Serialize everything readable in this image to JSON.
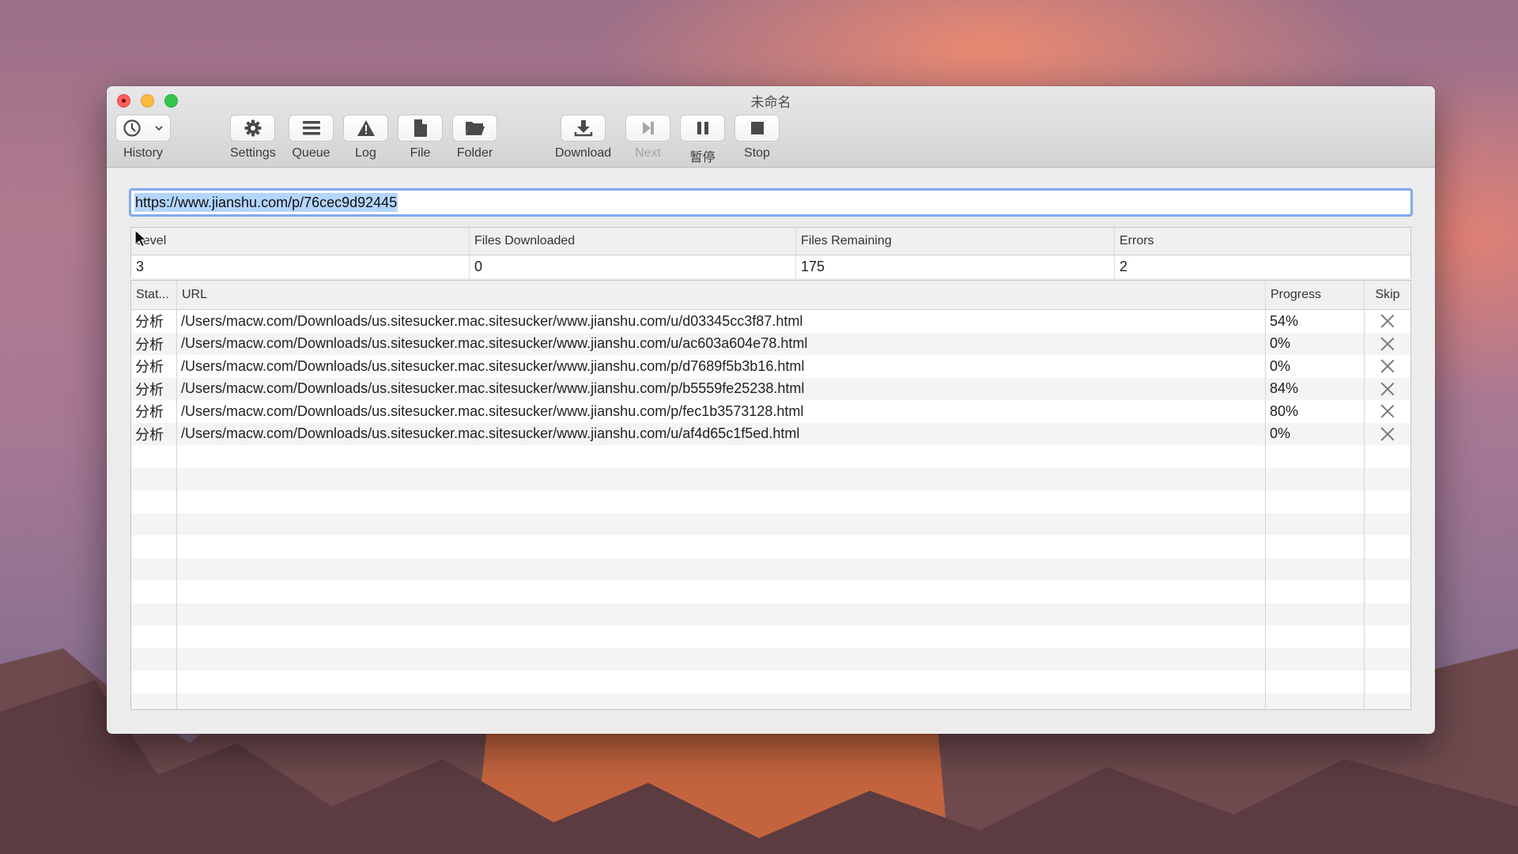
{
  "window": {
    "title": "未命名"
  },
  "toolbar": {
    "items": [
      {
        "label": "History",
        "icon": "clock-icon",
        "has_dropdown": true,
        "enabled": true
      },
      {
        "label": "Settings",
        "icon": "gear-icon",
        "enabled": true
      },
      {
        "label": "Queue",
        "icon": "list-icon",
        "enabled": true
      },
      {
        "label": "Log",
        "icon": "warning-icon",
        "enabled": true
      },
      {
        "label": "File",
        "icon": "file-icon",
        "enabled": true
      },
      {
        "label": "Folder",
        "icon": "folder-icon",
        "enabled": true
      },
      {
        "label": "Download",
        "icon": "download-icon",
        "enabled": true
      },
      {
        "label": "Next",
        "icon": "skip-next-icon",
        "enabled": false
      },
      {
        "label": "暂停",
        "icon": "pause-icon",
        "enabled": true
      },
      {
        "label": "Stop",
        "icon": "stop-icon",
        "enabled": true
      }
    ]
  },
  "url_field": {
    "value": "https://www.jianshu.com/p/76cec9d92445",
    "selected": true
  },
  "stats": {
    "headers": [
      "Level",
      "Files Downloaded",
      "Files Remaining",
      "Errors"
    ],
    "values": [
      "3",
      "0",
      "175",
      "2"
    ]
  },
  "queue": {
    "headers": [
      "Stat...",
      "URL",
      "Progress",
      "Skip"
    ],
    "rows": [
      {
        "status": "分析",
        "url": "/Users/macw.com/Downloads/us.sitesucker.mac.sitesucker/www.jianshu.com/u/d03345cc3f87.html",
        "progress": "54%"
      },
      {
        "status": "分析",
        "url": "/Users/macw.com/Downloads/us.sitesucker.mac.sitesucker/www.jianshu.com/u/ac603a604e78.html",
        "progress": "0%"
      },
      {
        "status": "分析",
        "url": "/Users/macw.com/Downloads/us.sitesucker.mac.sitesucker/www.jianshu.com/p/d7689f5b3b16.html",
        "progress": "0%"
      },
      {
        "status": "分析",
        "url": "/Users/macw.com/Downloads/us.sitesucker.mac.sitesucker/www.jianshu.com/p/b5559fe25238.html",
        "progress": "84%"
      },
      {
        "status": "分析",
        "url": "/Users/macw.com/Downloads/us.sitesucker.mac.sitesucker/www.jianshu.com/p/fec1b3573128.html",
        "progress": "80%"
      },
      {
        "status": "分析",
        "url": "/Users/macw.com/Downloads/us.sitesucker.mac.sitesucker/www.jianshu.com/u/af4d65c1f5ed.html",
        "progress": "0%"
      }
    ],
    "empty_rows": 12
  },
  "colors": {
    "selection": "#b4d5fe",
    "focus_ring": "#82a9ec",
    "close": "#fc605c",
    "minimize": "#fdbc40",
    "zoom": "#34c84a"
  }
}
